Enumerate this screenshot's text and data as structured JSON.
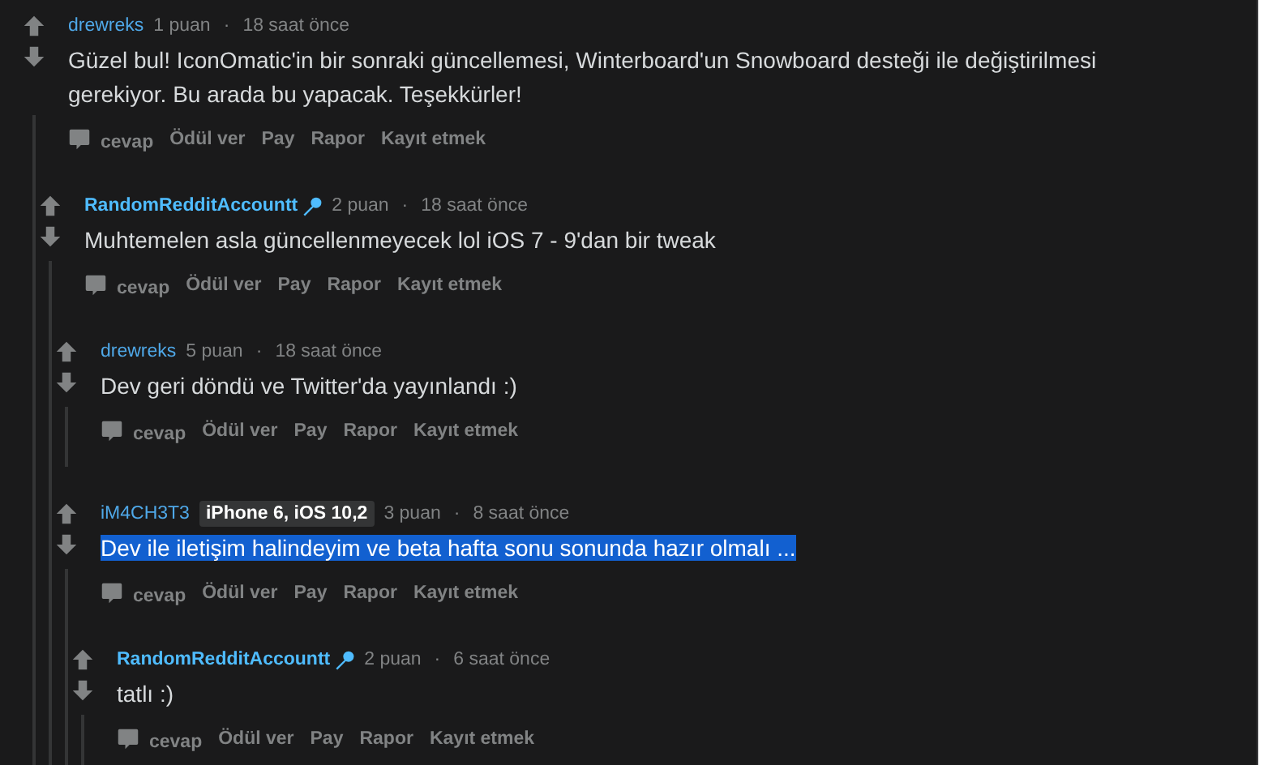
{
  "comments": [
    {
      "author": "drewreks",
      "is_op": false,
      "mic": false,
      "points": "1 puan",
      "separator": "·",
      "time": "18 saat önce",
      "body": "Güzel bul! IconOmatic'in bir sonraki güncellemesi, Winterboard'un Snowboard desteği ile değiştirilmesi gerekiyor. Bu arada bu yapacak. Teşekkürler!",
      "highlighted": false,
      "actions": [
        "cevap",
        "Ödül ver",
        "Pay",
        "Rapor",
        "Kayıt etmek"
      ],
      "children": [
        {
          "author": "RandomRedditAccountt",
          "is_op": true,
          "mic": true,
          "points": "2 puan",
          "separator": "·",
          "time": "18 saat önce",
          "body": "Muhtemelen asla güncellenmeyecek lol iOS 7 - 9'dan bir tweak",
          "highlighted": false,
          "actions": [
            "cevap",
            "Ödül ver",
            "Pay",
            "Rapor",
            "Kayıt etmek"
          ],
          "children": [
            {
              "author": "drewreks",
              "is_op": false,
              "mic": false,
              "points": "5 puan",
              "separator": "·",
              "time": "18 saat önce",
              "body": "Dev geri döndü ve Twitter'da yayınlandı :)",
              "highlighted": false,
              "actions": [
                "cevap",
                "Ödül ver",
                "Pay",
                "Rapor",
                "Kayıt etmek"
              ]
            },
            {
              "author": "iM4CH3T3",
              "is_op": false,
              "mic": false,
              "flair": "iPhone 6, iOS 10,2",
              "points": "3 puan",
              "separator": "·",
              "time": "8 saat önce",
              "body": "Dev ile iletişim halindeyim ve beta hafta sonu sonunda hazır olmalı ...",
              "highlighted": true,
              "actions": [
                "cevap",
                "Ödül ver",
                "Pay",
                "Rapor",
                "Kayıt etmek"
              ],
              "children": [
                {
                  "author": "RandomRedditAccountt",
                  "is_op": true,
                  "mic": true,
                  "points": "2 puan",
                  "separator": "·",
                  "time": "6 saat önce",
                  "body": "tatlı :)",
                  "highlighted": false,
                  "actions": [
                    "cevap",
                    "Ödül ver",
                    "Pay",
                    "Rapor",
                    "Kayıt etmek"
                  ]
                }
              ]
            }
          ]
        }
      ]
    }
  ]
}
